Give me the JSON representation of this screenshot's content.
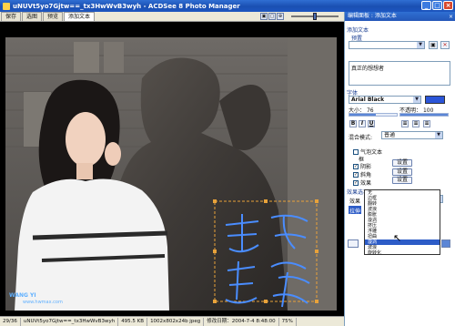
{
  "window": {
    "title": "uNUVt5yo7Gjtw==_tx3HwWvB3wyh - ACDSee 8 Photo Manager",
    "min": "_",
    "max": "□",
    "close": "×"
  },
  "tabs": [
    "保存",
    "选图",
    "预览",
    "添加文本"
  ],
  "panel": {
    "title": "编辑面板 : 添加文本",
    "close": "×",
    "section_text": "添加文本",
    "preset_label": "预置",
    "text_value": "真正的想想者",
    "font_section": "字体",
    "font_value": "Arial Black",
    "size_label": "大小：",
    "size_value": "76",
    "size_level": 0.56,
    "opacity_label": "不透明：",
    "opacity_value": "100",
    "opacity_level": 1.0,
    "format_buttons": [
      "B",
      "I",
      "U"
    ],
    "blend_label": "混合模式:",
    "blend_value": "普通",
    "bubble_label": "气泡文本",
    "frame_label": "框",
    "shadow_label": "阴影",
    "bevel_label": "斜角",
    "effect_label": "效果",
    "shadow_btn": "设置",
    "bevel_btn": "设置",
    "frame_btn": "设置",
    "effects_section": "效果选项",
    "effect_row_label": "效果",
    "effect_value": "漩涡",
    "effect_select_label": "拉伸",
    "effect_items": [
      "无",
      "边框",
      "翻转",
      "波浪",
      "膨胀",
      "漩涡",
      "挤压",
      "浮雕",
      "扭曲",
      "漩涡",
      "波浪",
      "旋转化"
    ],
    "effect_selected_index": 9
  },
  "statusbar": {
    "index": "29/36",
    "filename": "uNUVt5yo7Gjtw==_tx3HwWvB3wyh",
    "filesize": "495.5 KB",
    "dimensions": "1002x802x24b jpeg",
    "modified": "修改日期：2004-7-4 8:48:00",
    "zoom": "75%"
  },
  "watermark": {
    "brand": "WANG YI",
    "sub": "www.hwmax.com"
  },
  "overlay_text": "真正的想想者"
}
